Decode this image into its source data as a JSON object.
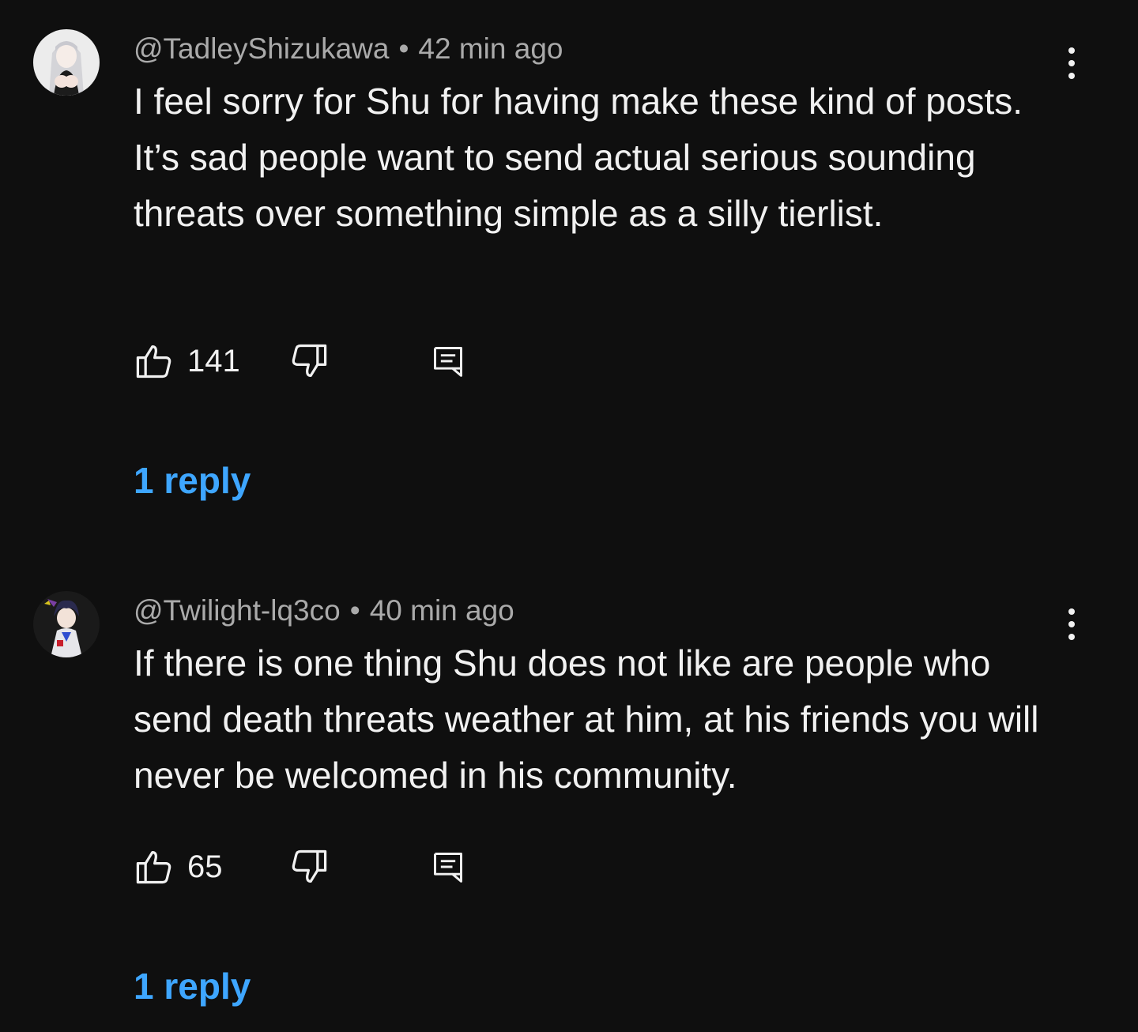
{
  "comments": [
    {
      "author": "@TadleyShizukawa",
      "separator": "•",
      "time": "42 min ago",
      "text": "I feel sorry for Shu for having make these kind of posts. It’s sad people want to send actual serious sounding threats over something simple as a silly tierlist.",
      "likes": "141",
      "replies_label": "1 reply",
      "avatar_icon": "avatar-white-haired-anime-girl"
    },
    {
      "author": "@Twilight-lq3co",
      "separator": "•",
      "time": "40 min ago",
      "text": "If there is one thing Shu does not like are people who send death threats weather at him, at his friends you will never be welcomed in his community.",
      "likes": "65",
      "replies_label": "1 reply",
      "avatar_icon": "avatar-dark-haired-anime-character"
    }
  ],
  "icons": {
    "like": "thumbs-up-icon",
    "dislike": "thumbs-down-icon",
    "reply": "reply-comment-icon",
    "more": "more-vertical-icon"
  },
  "colors": {
    "background": "#0f0f0f",
    "text": "#f1f1f1",
    "meta": "#aaaaaa",
    "link": "#3ea6ff"
  }
}
